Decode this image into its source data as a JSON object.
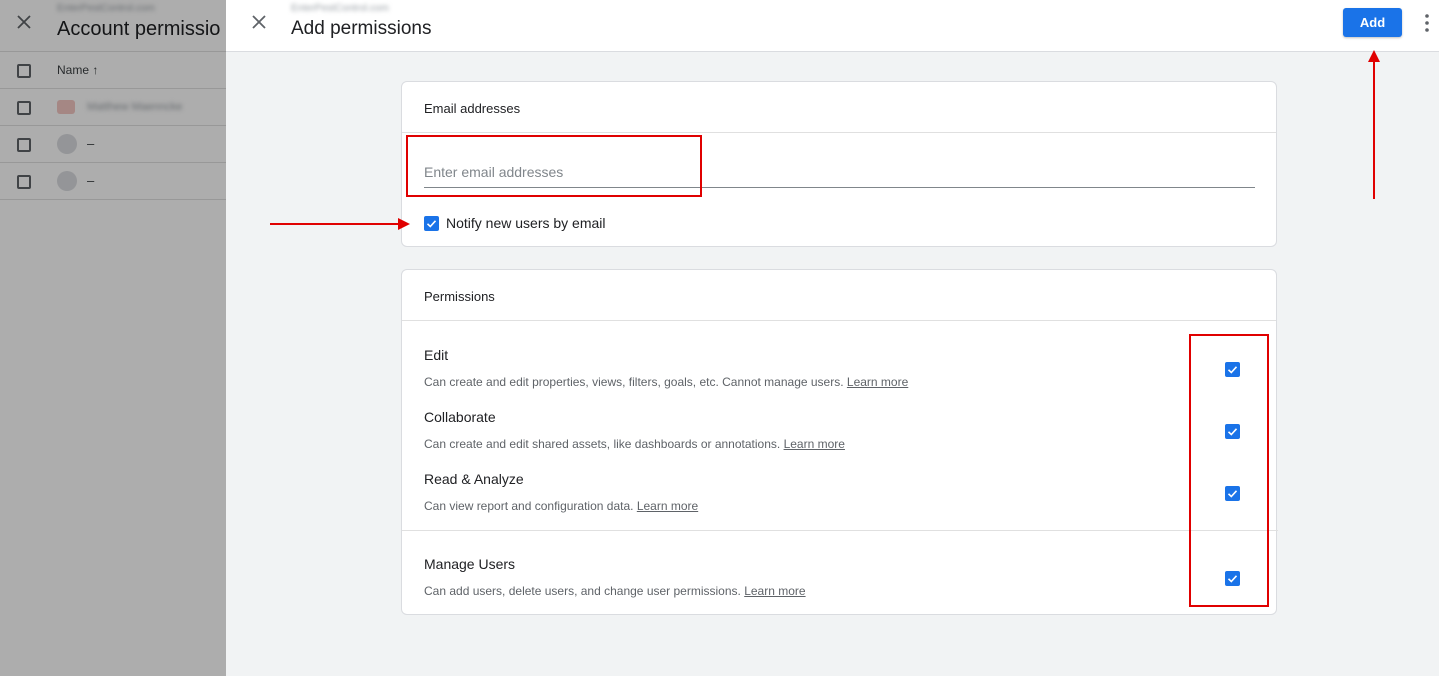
{
  "background": {
    "title": "Account permissio",
    "subtitle": "EnterPestControl.com",
    "table": {
      "name_header": "Name ↑",
      "rows": [
        {
          "name": "Matthew Maenncke"
        },
        {
          "name": "–"
        },
        {
          "name": "–"
        }
      ]
    }
  },
  "dialog": {
    "subtitle": "EnterPestControl.com",
    "title": "Add permissions",
    "add_label": "Add",
    "close_icon": "close-icon",
    "more_icon": "more-vert-icon"
  },
  "email_card": {
    "header": "Email addresses",
    "input_placeholder": "Enter email addresses",
    "input_value": "",
    "notify_label": "Notify new users by email",
    "notify_checked": true
  },
  "permissions_card": {
    "header": "Permissions",
    "items": [
      {
        "title": "Edit",
        "description": "Can create and edit properties, views, filters, goals, etc. Cannot manage users.",
        "link": "Learn more",
        "checked": true
      },
      {
        "title": "Collaborate",
        "description": "Can create and edit shared assets, like dashboards or annotations.",
        "link": "Learn more",
        "checked": true
      },
      {
        "title": "Read & Analyze",
        "description": "Can view report and configuration data.",
        "link": "Learn more",
        "checked": true
      },
      {
        "title": "Manage Users",
        "description": "Can add users, delete users, and change user permissions.",
        "link": "Learn more",
        "checked": true
      }
    ]
  },
  "colors": {
    "primary": "#1a73e8",
    "annotation": "#e00000",
    "background": "#f1f3f4"
  }
}
